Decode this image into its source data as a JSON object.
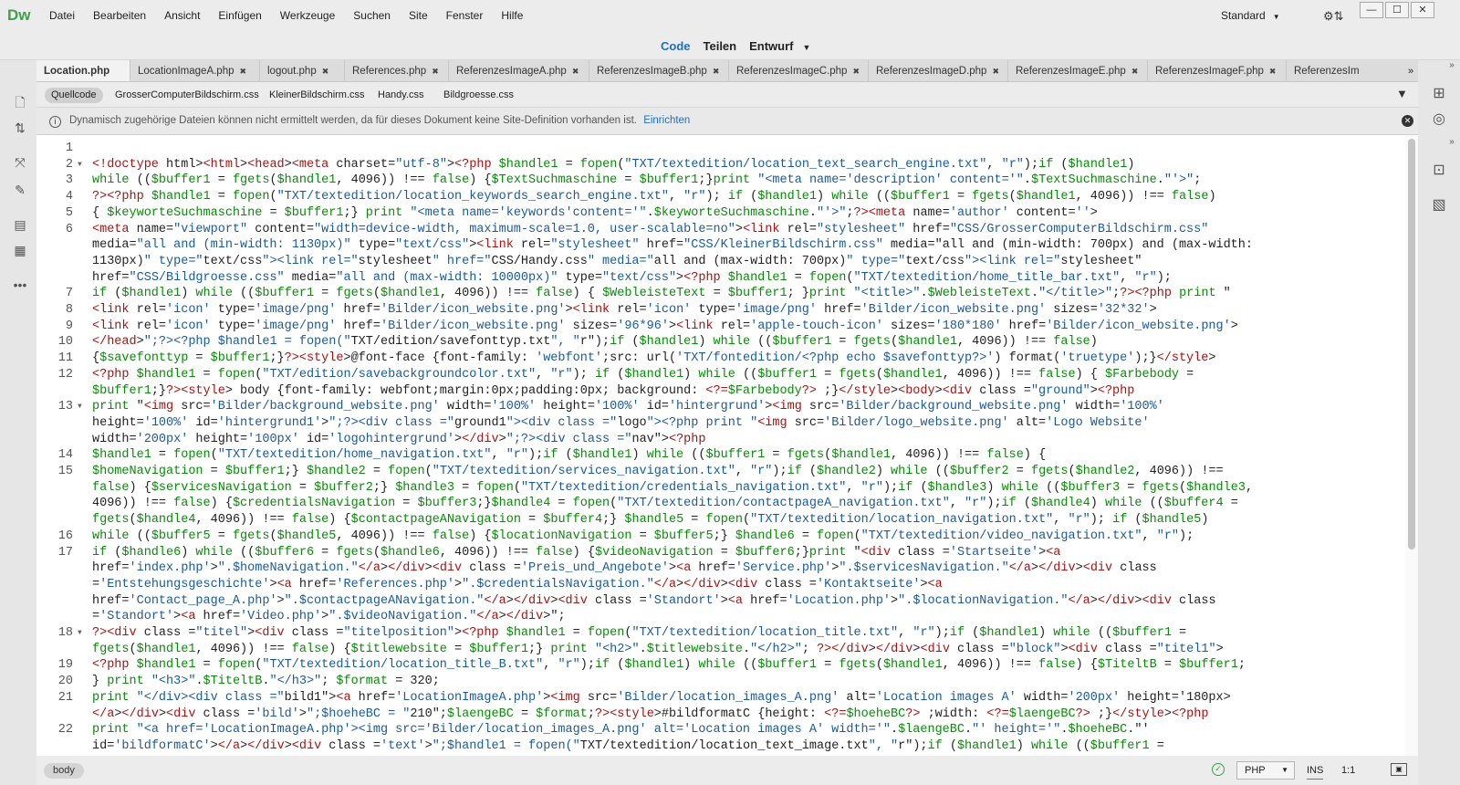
{
  "app": {
    "logo": "Dw"
  },
  "menu": [
    "Datei",
    "Bearbeiten",
    "Ansicht",
    "Einfügen",
    "Werkzeuge",
    "Suchen",
    "Site",
    "Fenster",
    "Hilfe"
  ],
  "layout": {
    "label": "Standard"
  },
  "views": {
    "code": "Code",
    "split": "Teilen",
    "design": "Entwurf"
  },
  "tabs": [
    {
      "label": "Location.php"
    },
    {
      "label": "LocationImageA.php"
    },
    {
      "label": "logout.php"
    },
    {
      "label": "References.php"
    },
    {
      "label": "ReferenzesImageA.php"
    },
    {
      "label": "ReferenzesImageB.php"
    },
    {
      "label": "ReferenzesImageC.php"
    },
    {
      "label": "ReferenzesImageD.php"
    },
    {
      "label": "ReferenzesImageE.php"
    },
    {
      "label": "ReferenzesImageF.php"
    },
    {
      "label": "ReferenzesIm"
    }
  ],
  "related_files": [
    "Quellcode",
    "GrosserComputerBildschirm.css",
    "KleinerBildschirm.css",
    "Handy.css",
    "Bildgroesse.css"
  ],
  "info": {
    "message": "Dynamisch zugehörige Dateien können nicht ermittelt werden, da für dieses Dokument keine Site-Definition vorhanden ist.",
    "link": "Einrichten"
  },
  "code_lines": [
    {
      "num": "1",
      "text": ""
    },
    {
      "num": "2",
      "text": "<!doctype html><html><head><meta charset=\"utf-8\"><?php $handle1 = fopen(\"TXT/textedition/location_text_search_engine.txt\", \"r\");if ($handle1)"
    },
    {
      "num": "3",
      "text": "while (($buffer1 = fgets($handle1, 4096)) !== false) {$TextSuchmaschine = $buffer1;}print \"<meta name='description' content='\".$TextSuchmaschine.\"'>\";"
    },
    {
      "num": "4",
      "text": "?><?php $handle1 = fopen(\"TXT/textedition/location_keywords_search_engine.txt\", \"r\"); if ($handle1) while (($buffer1 = fgets($handle1, 4096)) !== false)"
    },
    {
      "num": "5",
      "text": "{ $keyworteSuchmaschine = $buffer1;} print \"<meta name='keywords'content='\".$keyworteSuchmaschine.\"'>\";?><meta name='author' content=''>"
    },
    {
      "num": "6",
      "text": "<meta name=\"viewport\" content=\"width=device-width, maximum-scale=1.0, user-scalable=no\"><link rel=\"stylesheet\" href=\"CSS/GrosserComputerBildschirm.css\""
    },
    {
      "num": "",
      "text": "media=\"all and (min-width: 1130px)\" type=\"text/css\"><link rel=\"stylesheet\" href=\"CSS/KleinerBildschirm.css\" media=\"all and (min-width: 700px) and (max-width:"
    },
    {
      "num": "",
      "text": "1130px)\" type=\"text/css\"><link rel=\"stylesheet\" href=\"CSS/Handy.css\" media=\"all and (max-width: 700px)\" type=\"text/css\"><link rel=\"stylesheet\""
    },
    {
      "num": "",
      "text": "href=\"CSS/Bildgroesse.css\" media=\"all and (max-width: 10000px)\" type=\"text/css\"><?php $handle1 = fopen(\"TXT/textedition/home_title_bar.txt\", \"r\");"
    },
    {
      "num": "7",
      "text": "if ($handle1) while (($buffer1 = fgets($handle1, 4096)) !== false) { $WebleisteText = $buffer1; }print \"<title>\".$WebleisteText.\"</title>\";?><?php print \""
    },
    {
      "num": "8",
      "text": "<link rel='icon' type='image/png' href='Bilder/icon_website.png'><link rel='icon' type='image/png' href='Bilder/icon_website.png' sizes='32*32'>"
    },
    {
      "num": "9",
      "text": "<link rel='icon' type='image/png' href='Bilder/icon_website.png' sizes='96*96'><link rel='apple-touch-icon' sizes='180*180' href='Bilder/icon_website.png'>"
    },
    {
      "num": "10",
      "text": "</head>\";?><?php $handle1 = fopen(\"TXT/edition/savefonttyp.txt\", \"r\");if ($handle1) while (($buffer1 = fgets($handle1, 4096)) !== false)"
    },
    {
      "num": "11",
      "text": "{$savefonttyp = $buffer1;}?><style>@font-face  {font-family: 'webfont';src: url('TXT/fontedition/<?php echo $savefonttyp?>') format('truetype');}</style>"
    },
    {
      "num": "12",
      "text": "<?php $handle1 = fopen(\"TXT/edition/savebackgroundcolor.txt\", \"r\"); if ($handle1) while (($buffer1 = fgets($handle1, 4096)) !== false) { $Farbebody ="
    },
    {
      "num": "",
      "text": "$buffer1;}?><style> body  {font-family: webfont;margin:0px;padding:0px; background: <?=$Farbebody?> ;}</style><body><div class =\"ground\"><?php"
    },
    {
      "num": "13",
      "text": " print \"<img src='Bilder/background_website.png' width='100%' height='100%' id='hintergrund'><img src='Bilder/background_website.png' width='100%'"
    },
    {
      "num": "",
      "text": " height='100%' id='hintergrund1'>\";?><div class =\"ground1\"><div class =\"logo\"><?php print \"<img src='Bilder/logo_website.png' alt='Logo Website'"
    },
    {
      "num": "",
      "text": " width='200px' height='100px' id='logohintergrund'></div>\";?><div class =\"nav\"><?php"
    },
    {
      "num": "14",
      "text": "$handle1 = fopen(\"TXT/textedition/home_navigation.txt\", \"r\");if ($handle1) while (($buffer1 = fgets($handle1, 4096)) !== false) {"
    },
    {
      "num": "15",
      "text": "$homeNavigation = $buffer1;} $handle2 = fopen(\"TXT/textedition/services_navigation.txt\", \"r\");if ($handle2) while (($buffer2 = fgets($handle2, 4096)) !=="
    },
    {
      "num": "",
      "text": "false) {$servicesNavigation = $buffer2;} $handle3 = fopen(\"TXT/textedition/credentials_navigation.txt\", \"r\");if ($handle3) while (($buffer3 = fgets($handle3,"
    },
    {
      "num": "",
      "text": "4096)) !== false) {$credentialsNavigation = $buffer3;}$handle4 = fopen(\"TXT/textedition/contactpageA_navigation.txt\", \"r\");if ($handle4) while (($buffer4 ="
    },
    {
      "num": "",
      "text": "fgets($handle4, 4096)) !== false) {$contactpageANavigation = $buffer4;} $handle5 = fopen(\"TXT/textedition/location_navigation.txt\", \"r\"); if ($handle5)"
    },
    {
      "num": "16",
      "text": "while (($buffer5 = fgets($handle5, 4096)) !== false) {$locationNavigation = $buffer5;} $handle6 = fopen(\"TXT/textedition/video_navigation.txt\", \"r\");"
    },
    {
      "num": "17",
      "text": "if ($handle6) while (($buffer6 = fgets($handle6, 4096)) !== false) {$videoNavigation = $buffer6;}print \"<div class ='Startseite'><a"
    },
    {
      "num": "",
      "text": "href='index.php'>\".$homeNavigation.\"</a></div><div class ='Preis_und_Angebote'><a href='Service.php'>\".$servicesNavigation.\"</a></div><div class"
    },
    {
      "num": "",
      "text": "='Entstehungsgeschichte'><a href='References.php'>\".$credentialsNavigation.\"</a></div><div class ='Kontaktseite'><a"
    },
    {
      "num": "",
      "text": "href='Contact_page_A.php'>\".$contactpageANavigation.\"</a></div><div class ='Standort'><a href='Location.php'>\".$locationNavigation.\"</a></div><div class"
    },
    {
      "num": "",
      "text": "='Standort'><a href='Video.php'>\".$videoNavigation.\"</a></div>\";"
    },
    {
      "num": "18",
      "text": "?><div class =\"titel\"><div class =\"titelposition\"><?php $handle1 = fopen(\"TXT/textedition/location_title.txt\", \"r\");if ($handle1) while (($buffer1 ="
    },
    {
      "num": "",
      "text": "fgets($handle1, 4096)) !== false) {$titlewebsite = $buffer1;} print \"<h2>\".$titlewebsite.\"</h2>\";  ?></div></div><div class =\"block\"><div class =\"titel1\">"
    },
    {
      "num": "19",
      "text": "<?php $handle1 = fopen(\"TXT/textedition/location_title_B.txt\", \"r\");if ($handle1) while (($buffer1 = fgets($handle1, 4096)) !== false) {$TiteltB = $buffer1;"
    },
    {
      "num": "20",
      "text": "} print \"<h3>\".$TiteltB.\"</h3>\"; $format = 320;"
    },
    {
      "num": "21",
      "text": " print \"</div><div class =\"bild1\"><a href='LocationImageA.php'><img src='Bilder/location_images_A.png' alt='Location images A' width='200px' height='180px>"
    },
    {
      "num": "",
      "text": " </a></div><div class ='bild'>\";$hoeheBC = \"210\";$laengeBC = $format;?><style>#bildformatC  {height: <?=$hoeheBC?> ;width: <?=$laengeBC?> ;}</style><?php"
    },
    {
      "num": "22",
      "text": "print \"<a href='LocationImageA.php'><img src='Bilder/location_images_A.png' alt='Location images A' width='\".$laengeBC.\"' height='\".$hoeheBC.\"'"
    },
    {
      "num": "",
      "text": "id='bildformatC'></a></div><div class ='text'>\";$handle1 = fopen(\"TXT/textedition/location_text_image.txt\", \"r\");if ($handle1) while (($buffer1 ="
    }
  ],
  "status": {
    "tag": "body",
    "language": "PHP",
    "mode": "INS",
    "position": "1:1"
  },
  "colors": {
    "accent": "#1f6fbf",
    "logo": "#3fa04a",
    "tag": "#a31515",
    "php": "#b5651d",
    "keyword": "#0a8a0a",
    "string": "#1b5a98"
  }
}
